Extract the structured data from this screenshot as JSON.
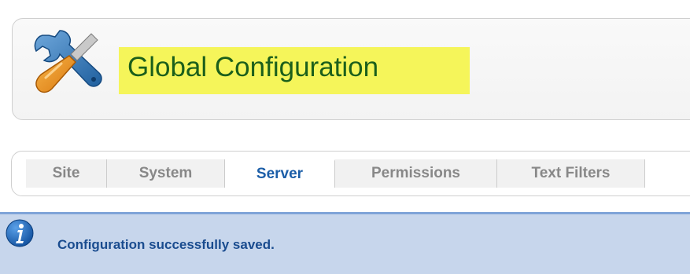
{
  "header": {
    "title": "Global Configuration",
    "icon": "wrench-screwdriver-icon",
    "highlight_color": "#f5f55a",
    "title_color": "#1b5f1b"
  },
  "tabs": [
    {
      "label": "Site",
      "active": false
    },
    {
      "label": "System",
      "active": false
    },
    {
      "label": "Server",
      "active": true
    },
    {
      "label": "Permissions",
      "active": false
    },
    {
      "label": "Text Filters",
      "active": false
    }
  ],
  "message": {
    "icon": "info-icon",
    "text": "Configuration successfully saved.",
    "background_color": "#c7d6ec",
    "text_color": "#1a4c8f"
  }
}
